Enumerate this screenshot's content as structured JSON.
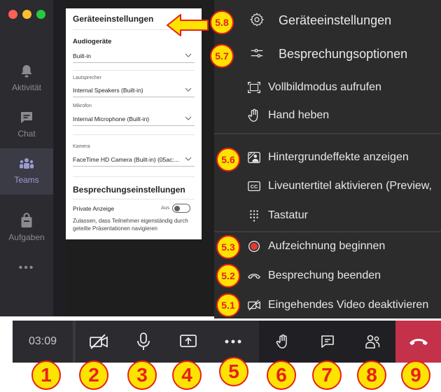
{
  "sidebar": {
    "items": [
      {
        "label": "Aktivität",
        "icon": "bell-icon"
      },
      {
        "label": "Chat",
        "icon": "chat-icon"
      },
      {
        "label": "Teams",
        "icon": "teams-icon"
      },
      {
        "label": "Aufgaben",
        "icon": "tasks-icon"
      }
    ],
    "more": "•••"
  },
  "settings": {
    "title": "Geräteeinstellungen",
    "audio_heading": "Audiogeräte",
    "audio_value": "Built-in",
    "speaker_label": "Lautsprecher",
    "speaker_value": "Internal Speakers (Built-in)",
    "mic_label": "Mikrofon",
    "mic_value": "Internal Microphone (Built-in)",
    "camera_label": "Kamera",
    "camera_value": "FaceTime HD Camera (Built-in) (05ac:...",
    "meeting_heading": "Besprechungseinstellungen",
    "private_label": "Private Anzeige",
    "private_state": "Aus",
    "private_desc": "Zulassen, dass Teilnehmer eigenständig durch geteilte Präsentationen navigieren"
  },
  "menu": {
    "items": [
      {
        "label": "Geräteeinstellungen",
        "icon": "gear-icon",
        "badge": "5.8"
      },
      {
        "label": "Besprechungsoptionen",
        "icon": "sliders-icon",
        "badge": "5.7"
      },
      {
        "label": "Vollbildmodus aufrufen",
        "icon": "fullscreen-icon"
      },
      {
        "label": "Hand heben",
        "icon": "hand-icon"
      },
      {
        "label": "Hintergrundeffekte anzeigen",
        "icon": "background-effects-icon",
        "badge": "5.6"
      },
      {
        "label": "Liveuntertitel aktivieren (Preview,",
        "icon": "captions-icon"
      },
      {
        "label": "Tastatur",
        "icon": "keypad-icon"
      },
      {
        "label": "Aufzeichnung beginnen",
        "icon": "record-icon",
        "badge": "5.3"
      },
      {
        "label": "Besprechung beenden",
        "icon": "end-call-icon",
        "badge": "5.2"
      },
      {
        "label": "Eingehendes Video deaktivieren",
        "icon": "video-off-icon",
        "badge": "5.1"
      }
    ]
  },
  "controlbar": {
    "timer": "03:09",
    "buttons": [
      {
        "name": "camera-off",
        "badge": "2"
      },
      {
        "name": "microphone",
        "badge": "3"
      },
      {
        "name": "share-screen",
        "badge": "4"
      },
      {
        "name": "more-actions",
        "badge": "5"
      },
      {
        "name": "raise-hand",
        "badge": "6"
      },
      {
        "name": "chat",
        "badge": "7"
      },
      {
        "name": "participants",
        "badge": "8"
      },
      {
        "name": "hang-up",
        "badge": "9"
      }
    ],
    "timer_badge": "1"
  },
  "colors": {
    "rail": "#2b2b30",
    "menu": "#2d2c2c",
    "hangup": "#c4314b",
    "badge_fill": "#fde300",
    "badge_stroke": "#e8201a",
    "accent": "#9a9ccf"
  }
}
